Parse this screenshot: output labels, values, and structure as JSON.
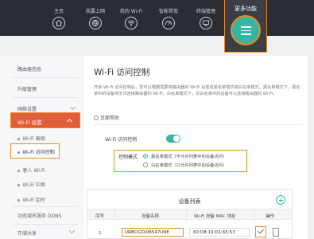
{
  "nav": {
    "items": [
      {
        "label": "主页",
        "icon": "home-icon"
      },
      {
        "label": "我要上网",
        "icon": "globe-icon"
      },
      {
        "label": "我的 Wi-Fi",
        "icon": "wifi-icon"
      },
      {
        "label": "智能带宽",
        "icon": "gauge-icon"
      },
      {
        "label": "终端管理",
        "icon": "devices-icon"
      }
    ],
    "more": {
      "label": "更多功能",
      "icon": "menu-icon"
    }
  },
  "sidebar": {
    "items": [
      {
        "label": "路由器信息"
      },
      {
        "label": "升级管理"
      },
      {
        "label": "网络设置"
      }
    ],
    "active_group": "Wi-Fi 设置",
    "sub_items": [
      "Wi-Fi 高级",
      "Wi-Fi 访问控制",
      "客人 Wi-Fi",
      "Wi-Fi 中继",
      "Wi-Fi 定时"
    ],
    "after_items": [
      "动态域名服务 DDNS",
      "存储共享"
    ]
  },
  "main": {
    "title": "Wi-Fi 访问控制",
    "description": "开启 Wi-Fi 访问控制后，您可以根据需要将路由器的 Wi-Fi 设置成黑名单模式或白名单模式。黑名单模式下，黑名单中的设备将无法连接路由器的 Wi-Fi；白名单模式下，仅白名单中的设备可以连接路由器的 Wi-Fi。",
    "help_label": "页面帮助",
    "control_label": "Wi-Fi 访问控制",
    "control_enabled": true,
    "mode_label": "控制模式",
    "modes": [
      {
        "text": "黑名单模式（不允许列表中的设备访问）",
        "selected": true
      },
      {
        "text": "白名单模式（只允许列表中的设备访问）",
        "selected": false
      }
    ],
    "device_list": {
      "title": "设备列表",
      "columns": [
        "序号",
        "设备名称",
        "Wi-Fi 设备 MAC 地址",
        "操作"
      ],
      "rows": [
        {
          "index": "1",
          "name": "URBCKZX0B547UNE",
          "mac": "60:D8:19:D1:65:53"
        }
      ]
    }
  },
  "colors": {
    "accent": "#35b5a4",
    "highlight": "#f08a1c",
    "active": "#e25e3a",
    "topbar": "#2a2d33"
  }
}
